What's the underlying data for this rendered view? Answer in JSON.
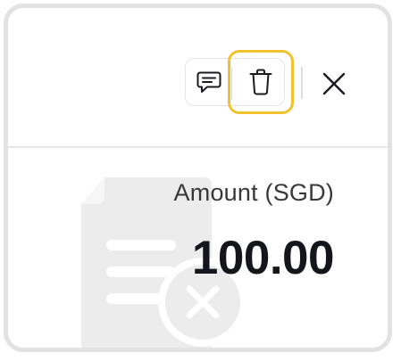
{
  "toolbar": {
    "comment_icon": "speech-bubble-icon",
    "delete_icon": "trash-icon",
    "close_icon": "close-icon",
    "highlight_color": "#f2c12e"
  },
  "amount": {
    "label": "Amount (SGD)",
    "value": "100.00"
  },
  "illustration": {
    "icon": "document-remove-icon",
    "color": "#ececec"
  }
}
